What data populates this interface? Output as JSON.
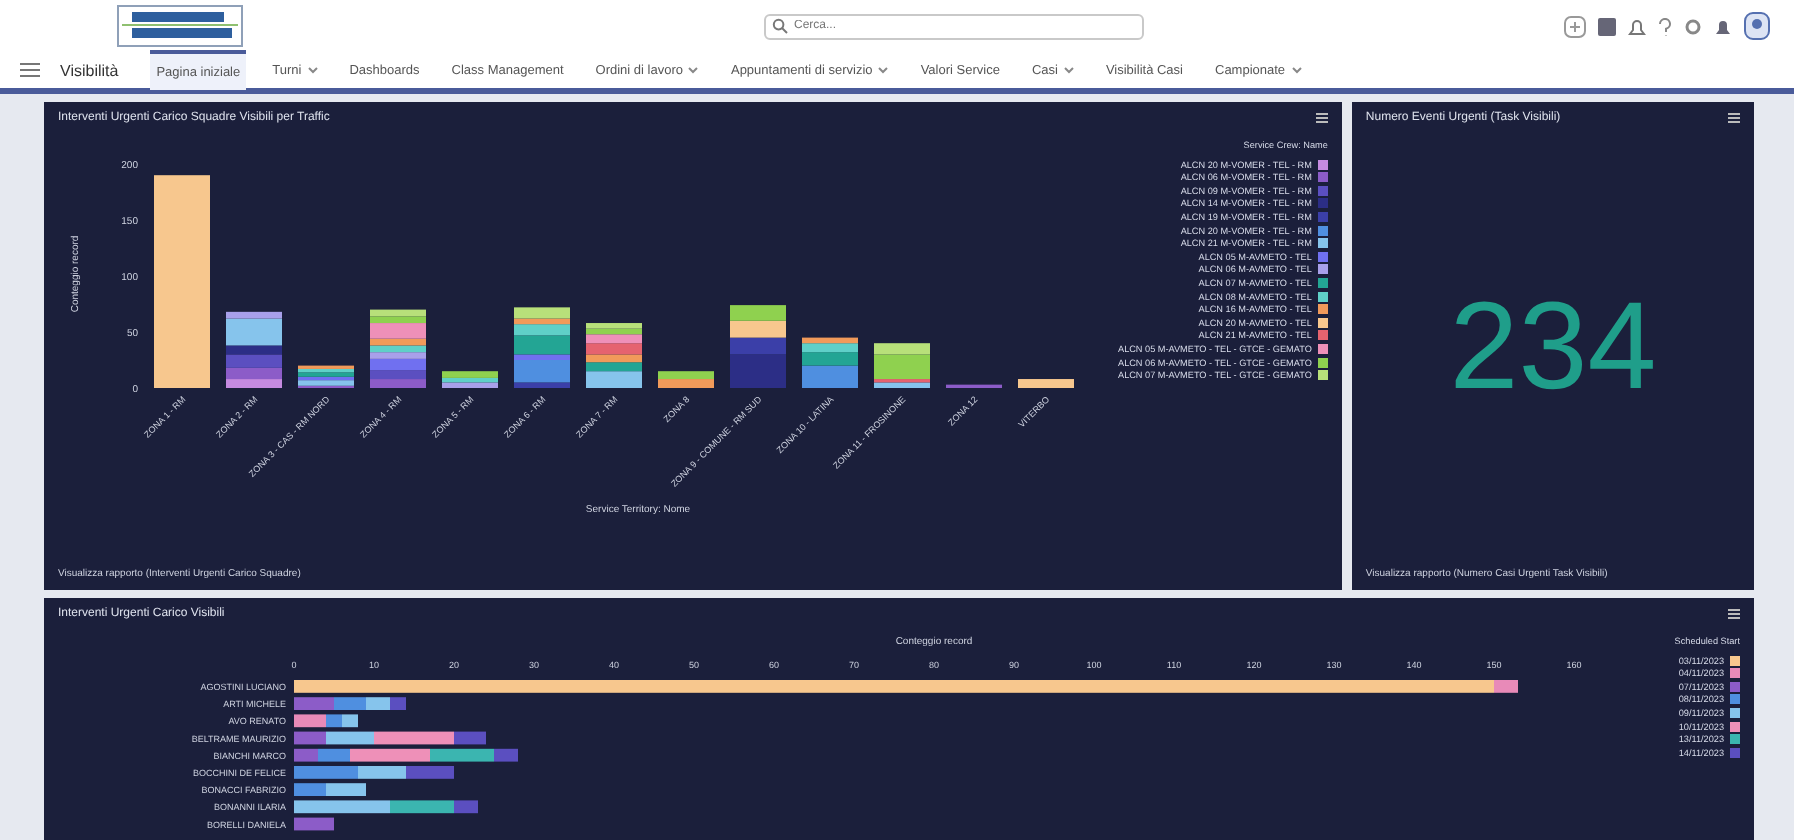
{
  "header": {
    "search": {
      "placeholder": "Cerca..."
    }
  },
  "nav": {
    "app_name": "Visibilità",
    "items": [
      {
        "label": "Pagina iniziale",
        "selected": true,
        "dropdown": false
      },
      {
        "label": "Turni",
        "selected": false,
        "dropdown": true
      },
      {
        "label": "Dashboards",
        "selected": false,
        "dropdown": false
      },
      {
        "label": "Class Management",
        "selected": false,
        "dropdown": false
      },
      {
        "label": "Ordini di lavoro",
        "selected": false,
        "dropdown": true
      },
      {
        "label": "Appuntamenti di servizio",
        "selected": false,
        "dropdown": true
      },
      {
        "label": "Valori Service",
        "selected": false,
        "dropdown": false
      },
      {
        "label": "Casi",
        "selected": false,
        "dropdown": true
      },
      {
        "label": "Visibilità Casi",
        "selected": false,
        "dropdown": false
      },
      {
        "label": "Campionate",
        "selected": false,
        "dropdown": true
      }
    ]
  },
  "top_chart": {
    "title": "Interventi Urgenti Carico Squadre Visibili per Traffic",
    "footer": "Visualizza rapporto (Interventi Urgenti Carico Squadre)",
    "legend_title": "Service Crew: Name",
    "chart_data": {
      "type": "bar",
      "stacked": true,
      "xlabel": "Service Territory: Nome",
      "ylabel": "Conteggio record",
      "ylim": [
        0,
        200
      ],
      "yticks": [
        0,
        50,
        100,
        150,
        200
      ],
      "categories": [
        "ZONA 1 - RM",
        "ZONA 2 - RM",
        "ZONA 3 - CAS - RM NORD",
        "ZONA 4 - RM",
        "ZONA 5 - RM",
        "ZONA 6 - RM",
        "ZONA 7 - RM",
        "ZONA 8",
        "ZONA 9 - COMUNE - RM SUD",
        "ZONA 10 - LATINA",
        "ZONA 11 - FROSINONE",
        "ZONA 12",
        "VITERBO"
      ],
      "series": [
        {
          "name": "ALCN 20 M-VOMER - TEL - RM",
          "color": "#c58ae0",
          "values": [
            0,
            8,
            0,
            0,
            0,
            0,
            0,
            0,
            0,
            0,
            0,
            0,
            0
          ]
        },
        {
          "name": "ALCN 06 M-VOMER - TEL - RM",
          "color": "#8c5cc8",
          "values": [
            0,
            10,
            2,
            8,
            0,
            0,
            0,
            0,
            0,
            0,
            0,
            3,
            0
          ]
        },
        {
          "name": "ALCN 09 M-VOMER - TEL - RM",
          "color": "#5b4fc0",
          "values": [
            0,
            12,
            0,
            8,
            0,
            0,
            0,
            0,
            0,
            0,
            0,
            0,
            0
          ]
        },
        {
          "name": "ALCN 14 M-VOMER - TEL - RM",
          "color": "#2c2e86",
          "values": [
            0,
            8,
            0,
            0,
            0,
            0,
            0,
            0,
            30,
            0,
            0,
            0,
            0
          ]
        },
        {
          "name": "ALCN 19 M-VOMER - TEL - RM",
          "color": "#3b3fa8",
          "values": [
            0,
            0,
            0,
            0,
            0,
            5,
            0,
            0,
            15,
            0,
            0,
            0,
            0
          ]
        },
        {
          "name": "ALCN 20 M-VOMER - TEL - RM",
          "color": "#4f8fe0",
          "values": [
            0,
            0,
            0,
            0,
            0,
            20,
            0,
            0,
            0,
            20,
            0,
            0,
            0
          ]
        },
        {
          "name": "ALCN 21 M-VOMER - TEL - RM",
          "color": "#86c4ec",
          "values": [
            0,
            24,
            5,
            0,
            0,
            0,
            15,
            0,
            0,
            0,
            5,
            0,
            0
          ]
        },
        {
          "name": "ALCN 05 M-AVMETO - TEL",
          "color": "#7070f0",
          "values": [
            0,
            0,
            3,
            10,
            0,
            5,
            0,
            0,
            0,
            0,
            0,
            0,
            0
          ]
        },
        {
          "name": "ALCN 06 M-AVMETO - TEL",
          "color": "#a8a0ea",
          "values": [
            0,
            6,
            0,
            6,
            5,
            0,
            0,
            0,
            0,
            0,
            0,
            0,
            0
          ]
        },
        {
          "name": "ALCN 07 M-AVMETO - TEL",
          "color": "#23a594",
          "values": [
            0,
            0,
            4,
            0,
            0,
            17,
            8,
            0,
            0,
            12,
            0,
            0,
            0
          ]
        },
        {
          "name": "ALCN 08 M-AVMETO - TEL",
          "color": "#5fd0c8",
          "values": [
            0,
            0,
            3,
            6,
            4,
            10,
            0,
            0,
            0,
            8,
            0,
            0,
            0
          ]
        },
        {
          "name": "ALCN 16 M-AVMETO - TEL",
          "color": "#f19a5a",
          "values": [
            0,
            0,
            3,
            6,
            0,
            5,
            7,
            8,
            0,
            5,
            0,
            0,
            0
          ]
        },
        {
          "name": "ALCN 20 M-AVMETO - TEL",
          "color": "#f7c78e",
          "values": [
            190,
            0,
            0,
            0,
            0,
            0,
            0,
            0,
            15,
            0,
            0,
            0,
            8
          ]
        },
        {
          "name": "ALCN 21 M-AVMETO - TEL",
          "color": "#e5636f",
          "values": [
            0,
            0,
            0,
            0,
            0,
            0,
            10,
            0,
            0,
            0,
            3,
            0,
            0
          ]
        },
        {
          "name": "ALCN 05 M-AVMETO - TEL - GTCE - GEMATO",
          "color": "#ee90b8",
          "values": [
            0,
            0,
            0,
            14,
            0,
            0,
            8,
            0,
            0,
            0,
            0,
            0,
            0
          ]
        },
        {
          "name": "ALCN 06 M-AVMETO - TEL - GTCE - GEMATO",
          "color": "#8fd14f",
          "values": [
            0,
            0,
            0,
            6,
            6,
            0,
            5,
            7,
            14,
            0,
            22,
            0,
            0
          ]
        },
        {
          "name": "ALCN 07 M-AVMETO - TEL - GTCE - GEMATO",
          "color": "#b8e07a",
          "values": [
            0,
            0,
            0,
            6,
            0,
            10,
            5,
            0,
            0,
            0,
            10,
            0,
            0
          ]
        }
      ]
    }
  },
  "count_panel": {
    "title": "Numero Eventi Urgenti (Task Visibili)",
    "value": "234",
    "footer": "Visualizza rapporto (Numero Casi Urgenti Task Visibili)"
  },
  "bottom_chart": {
    "title": "Interventi Urgenti Carico Visibili",
    "legend_title": "Scheduled Start",
    "chart_data": {
      "type": "bar",
      "orientation": "horizontal",
      "stacked": true,
      "xlabel": "Conteggio record",
      "xlim": [
        0,
        160
      ],
      "xticks": [
        0,
        10,
        20,
        30,
        40,
        50,
        60,
        70,
        80,
        90,
        100,
        110,
        120,
        130,
        140,
        150,
        160
      ],
      "categories": [
        "AGOSTINI LUCIANO",
        "ARTI MICHELE",
        "AVO RENATO",
        "BELTRAME MAURIZIO",
        "BIANCHI MARCO",
        "BOCCHINI DE FELICE",
        "BONACCI FABRIZIO",
        "BONANNI ILARIA",
        "BORELLI DANIELA"
      ],
      "series": [
        {
          "name": "03/11/2023",
          "color": "#f7c78e",
          "values": [
            150,
            0,
            0,
            0,
            0,
            0,
            0,
            0,
            0
          ]
        },
        {
          "name": "04/11/2023",
          "color": "#e88ab8",
          "values": [
            3,
            0,
            4,
            0,
            0,
            0,
            0,
            0,
            0
          ]
        },
        {
          "name": "07/11/2023",
          "color": "#8c5cc8",
          "values": [
            0,
            5,
            0,
            4,
            3,
            0,
            0,
            0,
            5
          ]
        },
        {
          "name": "08/11/2023",
          "color": "#4f8fe0",
          "values": [
            0,
            4,
            2,
            0,
            4,
            8,
            4,
            0,
            0
          ]
        },
        {
          "name": "09/11/2023",
          "color": "#86c4ec",
          "values": [
            0,
            3,
            2,
            6,
            0,
            6,
            5,
            12,
            0
          ]
        },
        {
          "name": "10/11/2023",
          "color": "#ee90b8",
          "values": [
            0,
            0,
            0,
            10,
            10,
            0,
            0,
            0,
            0
          ]
        },
        {
          "name": "13/11/2023",
          "color": "#3bb5b0",
          "values": [
            0,
            0,
            0,
            0,
            8,
            0,
            0,
            8,
            0
          ]
        },
        {
          "name": "14/11/2023",
          "color": "#5b4fc0",
          "values": [
            0,
            2,
            0,
            4,
            3,
            6,
            0,
            3,
            0
          ]
        }
      ]
    }
  }
}
